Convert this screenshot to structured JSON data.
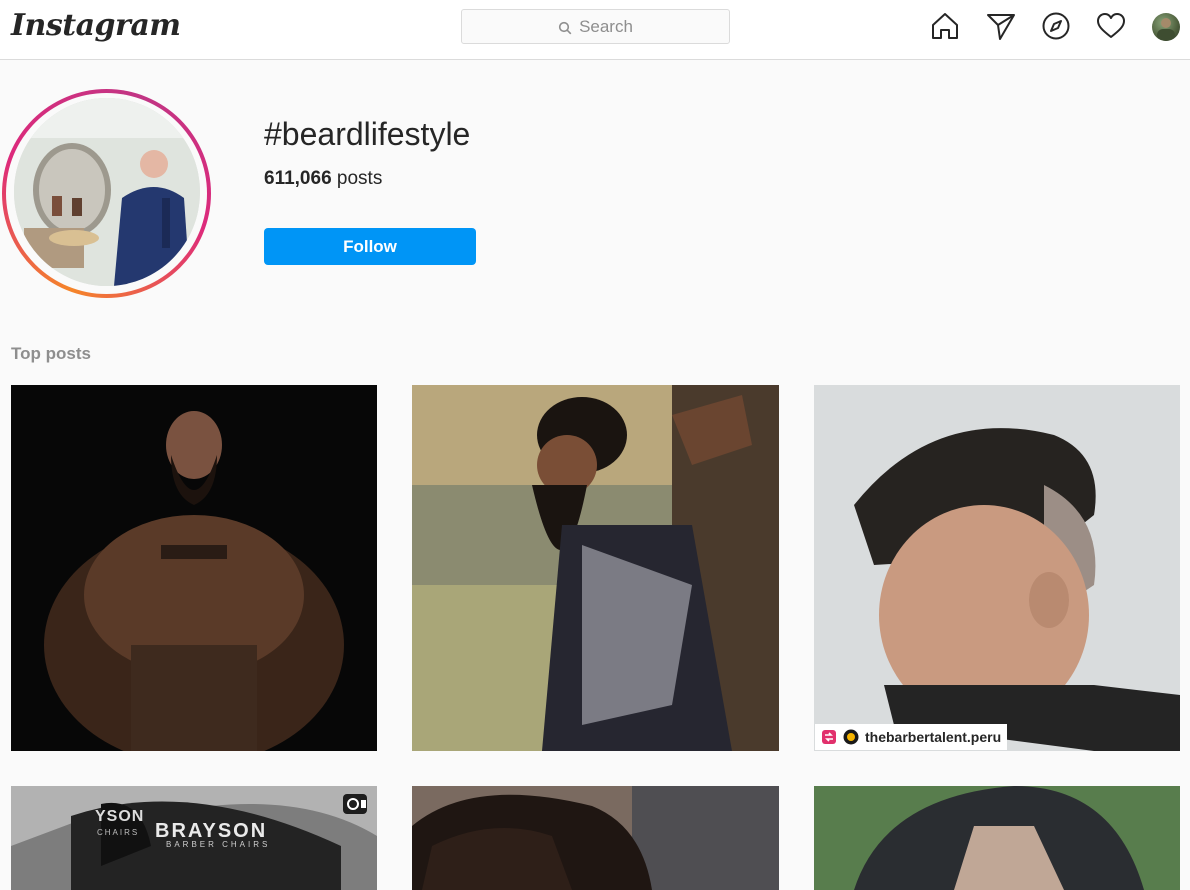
{
  "nav": {
    "logo": "Instagram",
    "search_placeholder": "Search",
    "icons": [
      "home-icon",
      "direct-icon",
      "explore-icon",
      "activity-icon",
      "profile-avatar"
    ]
  },
  "hashtag": {
    "title": "#beardlifestyle",
    "post_count": "611,066",
    "post_count_label": "posts",
    "follow_label": "Follow"
  },
  "sections": {
    "top_posts_label": "Top posts"
  },
  "posts": [
    {
      "alt": "post-1"
    },
    {
      "alt": "post-2"
    },
    {
      "alt": "post-3",
      "tag_user": "thebarbertalent.peru"
    },
    {
      "alt": "post-4",
      "overlay_text": "BRAYSON",
      "overlay_sub": "BARBER CHAIRS",
      "overlay_left": "YSON",
      "overlay_left_sub": "CHAIRS"
    },
    {
      "alt": "post-5"
    },
    {
      "alt": "post-6"
    }
  ],
  "colors": {
    "accent": "#0095f6",
    "ring_start": "#f58529",
    "ring_end": "#dd2a7b"
  }
}
